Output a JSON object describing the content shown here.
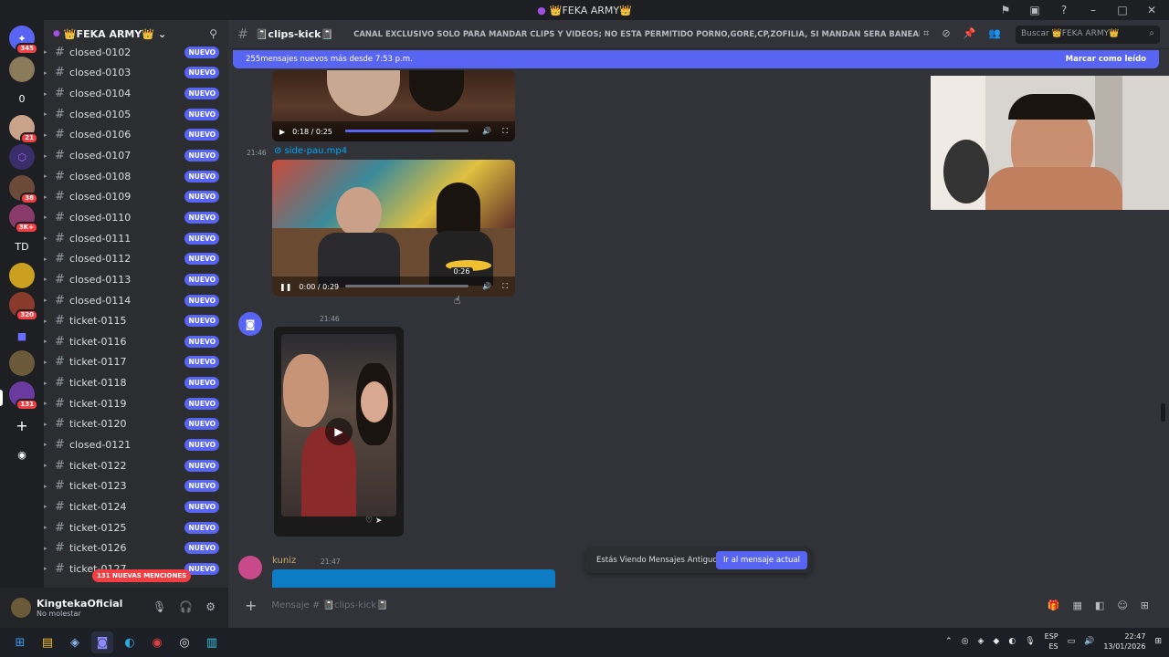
{
  "window": {
    "title": "👑FEKA ARMY👑"
  },
  "rail": {
    "servers": [
      {
        "label": "",
        "badge": "345"
      },
      {
        "label": "",
        "badge": ""
      },
      {
        "label": "0",
        "badge": ""
      },
      {
        "label": "",
        "badge": "21"
      },
      {
        "label": "",
        "badge": ""
      },
      {
        "label": "",
        "badge": "38"
      },
      {
        "label": "",
        "badge": "3K+"
      },
      {
        "label": "TD",
        "badge": ""
      },
      {
        "label": "",
        "badge": ""
      },
      {
        "label": "",
        "badge": "320"
      },
      {
        "label": "",
        "badge": ""
      },
      {
        "label": "",
        "badge": ""
      },
      {
        "label": "",
        "badge": "131"
      }
    ]
  },
  "server": {
    "name": "👑FEKA ARMY👑"
  },
  "channels": [
    {
      "name": "closed-0102",
      "badge": "NUEVO"
    },
    {
      "name": "closed-0103",
      "badge": "NUEVO"
    },
    {
      "name": "closed-0104",
      "badge": "NUEVO"
    },
    {
      "name": "closed-0105",
      "badge": "NUEVO"
    },
    {
      "name": "closed-0106",
      "badge": "NUEVO"
    },
    {
      "name": "closed-0107",
      "badge": "NUEVO"
    },
    {
      "name": "closed-0108",
      "badge": "NUEVO"
    },
    {
      "name": "closed-0109",
      "badge": "NUEVO"
    },
    {
      "name": "closed-0110",
      "badge": "NUEVO"
    },
    {
      "name": "closed-0111",
      "badge": "NUEVO"
    },
    {
      "name": "closed-0112",
      "badge": "NUEVO"
    },
    {
      "name": "closed-0113",
      "badge": "NUEVO"
    },
    {
      "name": "closed-0114",
      "badge": "NUEVO"
    },
    {
      "name": "ticket-0115",
      "badge": "NUEVO"
    },
    {
      "name": "ticket-0116",
      "badge": "NUEVO"
    },
    {
      "name": "ticket-0117",
      "badge": "NUEVO"
    },
    {
      "name": "ticket-0118",
      "badge": "NUEVO"
    },
    {
      "name": "ticket-0119",
      "badge": "NUEVO"
    },
    {
      "name": "ticket-0120",
      "badge": "NUEVO"
    },
    {
      "name": "closed-0121",
      "badge": "NUEVO"
    },
    {
      "name": "ticket-0122",
      "badge": "NUEVO"
    },
    {
      "name": "ticket-0123",
      "badge": "NUEVO"
    },
    {
      "name": "ticket-0124",
      "badge": "NUEVO"
    },
    {
      "name": "ticket-0125",
      "badge": "NUEVO"
    },
    {
      "name": "ticket-0126",
      "badge": "NUEVO"
    },
    {
      "name": "ticket-0127",
      "badge": "NUEVO"
    }
  ],
  "mentions_pill": "131 NUEVAS MENCIONES",
  "user": {
    "name": "KingtekaOficial",
    "status": "No molestar"
  },
  "channel": {
    "name": "📓clips-kick📓",
    "topic": "CANAL EXCLUSIVO SOLO PARA MANDAR CLIPS Y VIDEOS; NO ESTA PERMITIDO PORNO,GORE,CP,ZOFILIA, SI MANDAN SERA BANEADO PERMA...",
    "search_placeholder": "Buscar 👑FEKA ARMY👑"
  },
  "new_messages": {
    "text": "255mensajes nuevos más desde 7:53 p.m.",
    "action": "Marcar como leído"
  },
  "messages": {
    "video1": {
      "time": "0:18 / 0:25",
      "progress": 0.72
    },
    "video2": {
      "timestamp": "21:46",
      "filename": "side-pau.mp4",
      "time": "0:00 / 0:29",
      "hover_time": "0:26",
      "progress": 0.0
    },
    "msg3": {
      "timestamp": "21:46"
    },
    "msg4": {
      "author": "kuniz",
      "timestamp": "21:47"
    }
  },
  "old_notice": {
    "text": "Estás Viendo Mensajes Antiguos",
    "button": "Ir al mensaje actual"
  },
  "composer": {
    "placeholder": "Mensaje # 📓clips-kick📓"
  },
  "taskbar": {
    "lang": "ESP",
    "lang2": "ES",
    "time": "22:47",
    "date": "13/01/2026"
  }
}
